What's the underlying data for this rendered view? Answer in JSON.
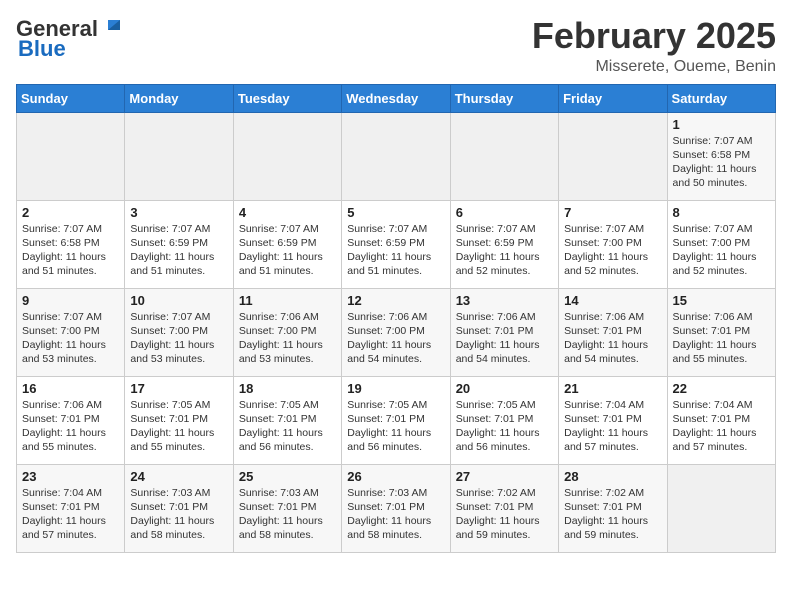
{
  "header": {
    "logo_general": "General",
    "logo_blue": "Blue",
    "month_title": "February 2025",
    "location": "Misserete, Oueme, Benin"
  },
  "weekdays": [
    "Sunday",
    "Monday",
    "Tuesday",
    "Wednesday",
    "Thursday",
    "Friday",
    "Saturday"
  ],
  "weeks": [
    [
      {
        "day": "",
        "info": ""
      },
      {
        "day": "",
        "info": ""
      },
      {
        "day": "",
        "info": ""
      },
      {
        "day": "",
        "info": ""
      },
      {
        "day": "",
        "info": ""
      },
      {
        "day": "",
        "info": ""
      },
      {
        "day": "1",
        "info": "Sunrise: 7:07 AM\nSunset: 6:58 PM\nDaylight: 11 hours\nand 50 minutes."
      }
    ],
    [
      {
        "day": "2",
        "info": "Sunrise: 7:07 AM\nSunset: 6:58 PM\nDaylight: 11 hours\nand 51 minutes."
      },
      {
        "day": "3",
        "info": "Sunrise: 7:07 AM\nSunset: 6:59 PM\nDaylight: 11 hours\nand 51 minutes."
      },
      {
        "day": "4",
        "info": "Sunrise: 7:07 AM\nSunset: 6:59 PM\nDaylight: 11 hours\nand 51 minutes."
      },
      {
        "day": "5",
        "info": "Sunrise: 7:07 AM\nSunset: 6:59 PM\nDaylight: 11 hours\nand 51 minutes."
      },
      {
        "day": "6",
        "info": "Sunrise: 7:07 AM\nSunset: 6:59 PM\nDaylight: 11 hours\nand 52 minutes."
      },
      {
        "day": "7",
        "info": "Sunrise: 7:07 AM\nSunset: 7:00 PM\nDaylight: 11 hours\nand 52 minutes."
      },
      {
        "day": "8",
        "info": "Sunrise: 7:07 AM\nSunset: 7:00 PM\nDaylight: 11 hours\nand 52 minutes."
      }
    ],
    [
      {
        "day": "9",
        "info": "Sunrise: 7:07 AM\nSunset: 7:00 PM\nDaylight: 11 hours\nand 53 minutes."
      },
      {
        "day": "10",
        "info": "Sunrise: 7:07 AM\nSunset: 7:00 PM\nDaylight: 11 hours\nand 53 minutes."
      },
      {
        "day": "11",
        "info": "Sunrise: 7:06 AM\nSunset: 7:00 PM\nDaylight: 11 hours\nand 53 minutes."
      },
      {
        "day": "12",
        "info": "Sunrise: 7:06 AM\nSunset: 7:00 PM\nDaylight: 11 hours\nand 54 minutes."
      },
      {
        "day": "13",
        "info": "Sunrise: 7:06 AM\nSunset: 7:01 PM\nDaylight: 11 hours\nand 54 minutes."
      },
      {
        "day": "14",
        "info": "Sunrise: 7:06 AM\nSunset: 7:01 PM\nDaylight: 11 hours\nand 54 minutes."
      },
      {
        "day": "15",
        "info": "Sunrise: 7:06 AM\nSunset: 7:01 PM\nDaylight: 11 hours\nand 55 minutes."
      }
    ],
    [
      {
        "day": "16",
        "info": "Sunrise: 7:06 AM\nSunset: 7:01 PM\nDaylight: 11 hours\nand 55 minutes."
      },
      {
        "day": "17",
        "info": "Sunrise: 7:05 AM\nSunset: 7:01 PM\nDaylight: 11 hours\nand 55 minutes."
      },
      {
        "day": "18",
        "info": "Sunrise: 7:05 AM\nSunset: 7:01 PM\nDaylight: 11 hours\nand 56 minutes."
      },
      {
        "day": "19",
        "info": "Sunrise: 7:05 AM\nSunset: 7:01 PM\nDaylight: 11 hours\nand 56 minutes."
      },
      {
        "day": "20",
        "info": "Sunrise: 7:05 AM\nSunset: 7:01 PM\nDaylight: 11 hours\nand 56 minutes."
      },
      {
        "day": "21",
        "info": "Sunrise: 7:04 AM\nSunset: 7:01 PM\nDaylight: 11 hours\nand 57 minutes."
      },
      {
        "day": "22",
        "info": "Sunrise: 7:04 AM\nSunset: 7:01 PM\nDaylight: 11 hours\nand 57 minutes."
      }
    ],
    [
      {
        "day": "23",
        "info": "Sunrise: 7:04 AM\nSunset: 7:01 PM\nDaylight: 11 hours\nand 57 minutes."
      },
      {
        "day": "24",
        "info": "Sunrise: 7:03 AM\nSunset: 7:01 PM\nDaylight: 11 hours\nand 58 minutes."
      },
      {
        "day": "25",
        "info": "Sunrise: 7:03 AM\nSunset: 7:01 PM\nDaylight: 11 hours\nand 58 minutes."
      },
      {
        "day": "26",
        "info": "Sunrise: 7:03 AM\nSunset: 7:01 PM\nDaylight: 11 hours\nand 58 minutes."
      },
      {
        "day": "27",
        "info": "Sunrise: 7:02 AM\nSunset: 7:01 PM\nDaylight: 11 hours\nand 59 minutes."
      },
      {
        "day": "28",
        "info": "Sunrise: 7:02 AM\nSunset: 7:01 PM\nDaylight: 11 hours\nand 59 minutes."
      },
      {
        "day": "",
        "info": ""
      }
    ]
  ]
}
